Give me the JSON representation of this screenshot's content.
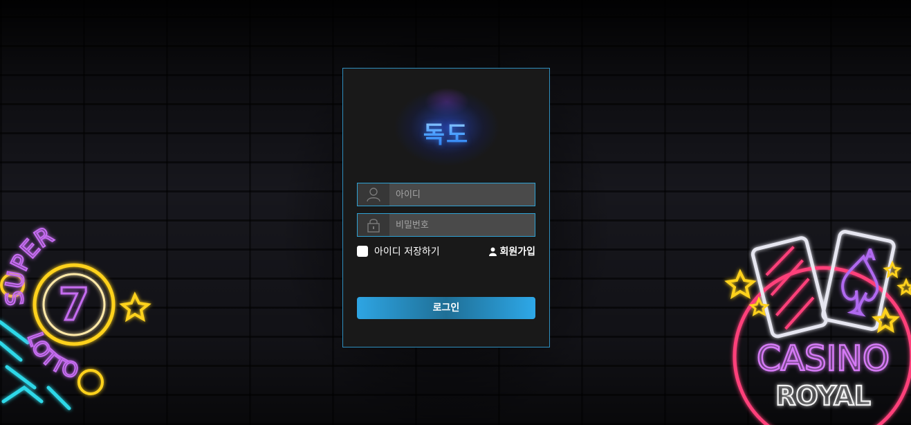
{
  "login": {
    "logo_text": "독도",
    "username_placeholder": "아이디",
    "password_placeholder": "비밀번호",
    "remember_label": "아이디 저장하기",
    "signup_label": "회원가입",
    "login_button": "로그인"
  },
  "neon_left": {
    "text_top": "SUPER",
    "number": "7",
    "text_bottom": "LOTTO"
  },
  "neon_right": {
    "card_letter": "A",
    "text_main": "CASINO",
    "text_sub": "ROYAL"
  },
  "colors": {
    "accent": "#2fa3d6",
    "button": "#2ea5e3",
    "panel": "#191919"
  }
}
